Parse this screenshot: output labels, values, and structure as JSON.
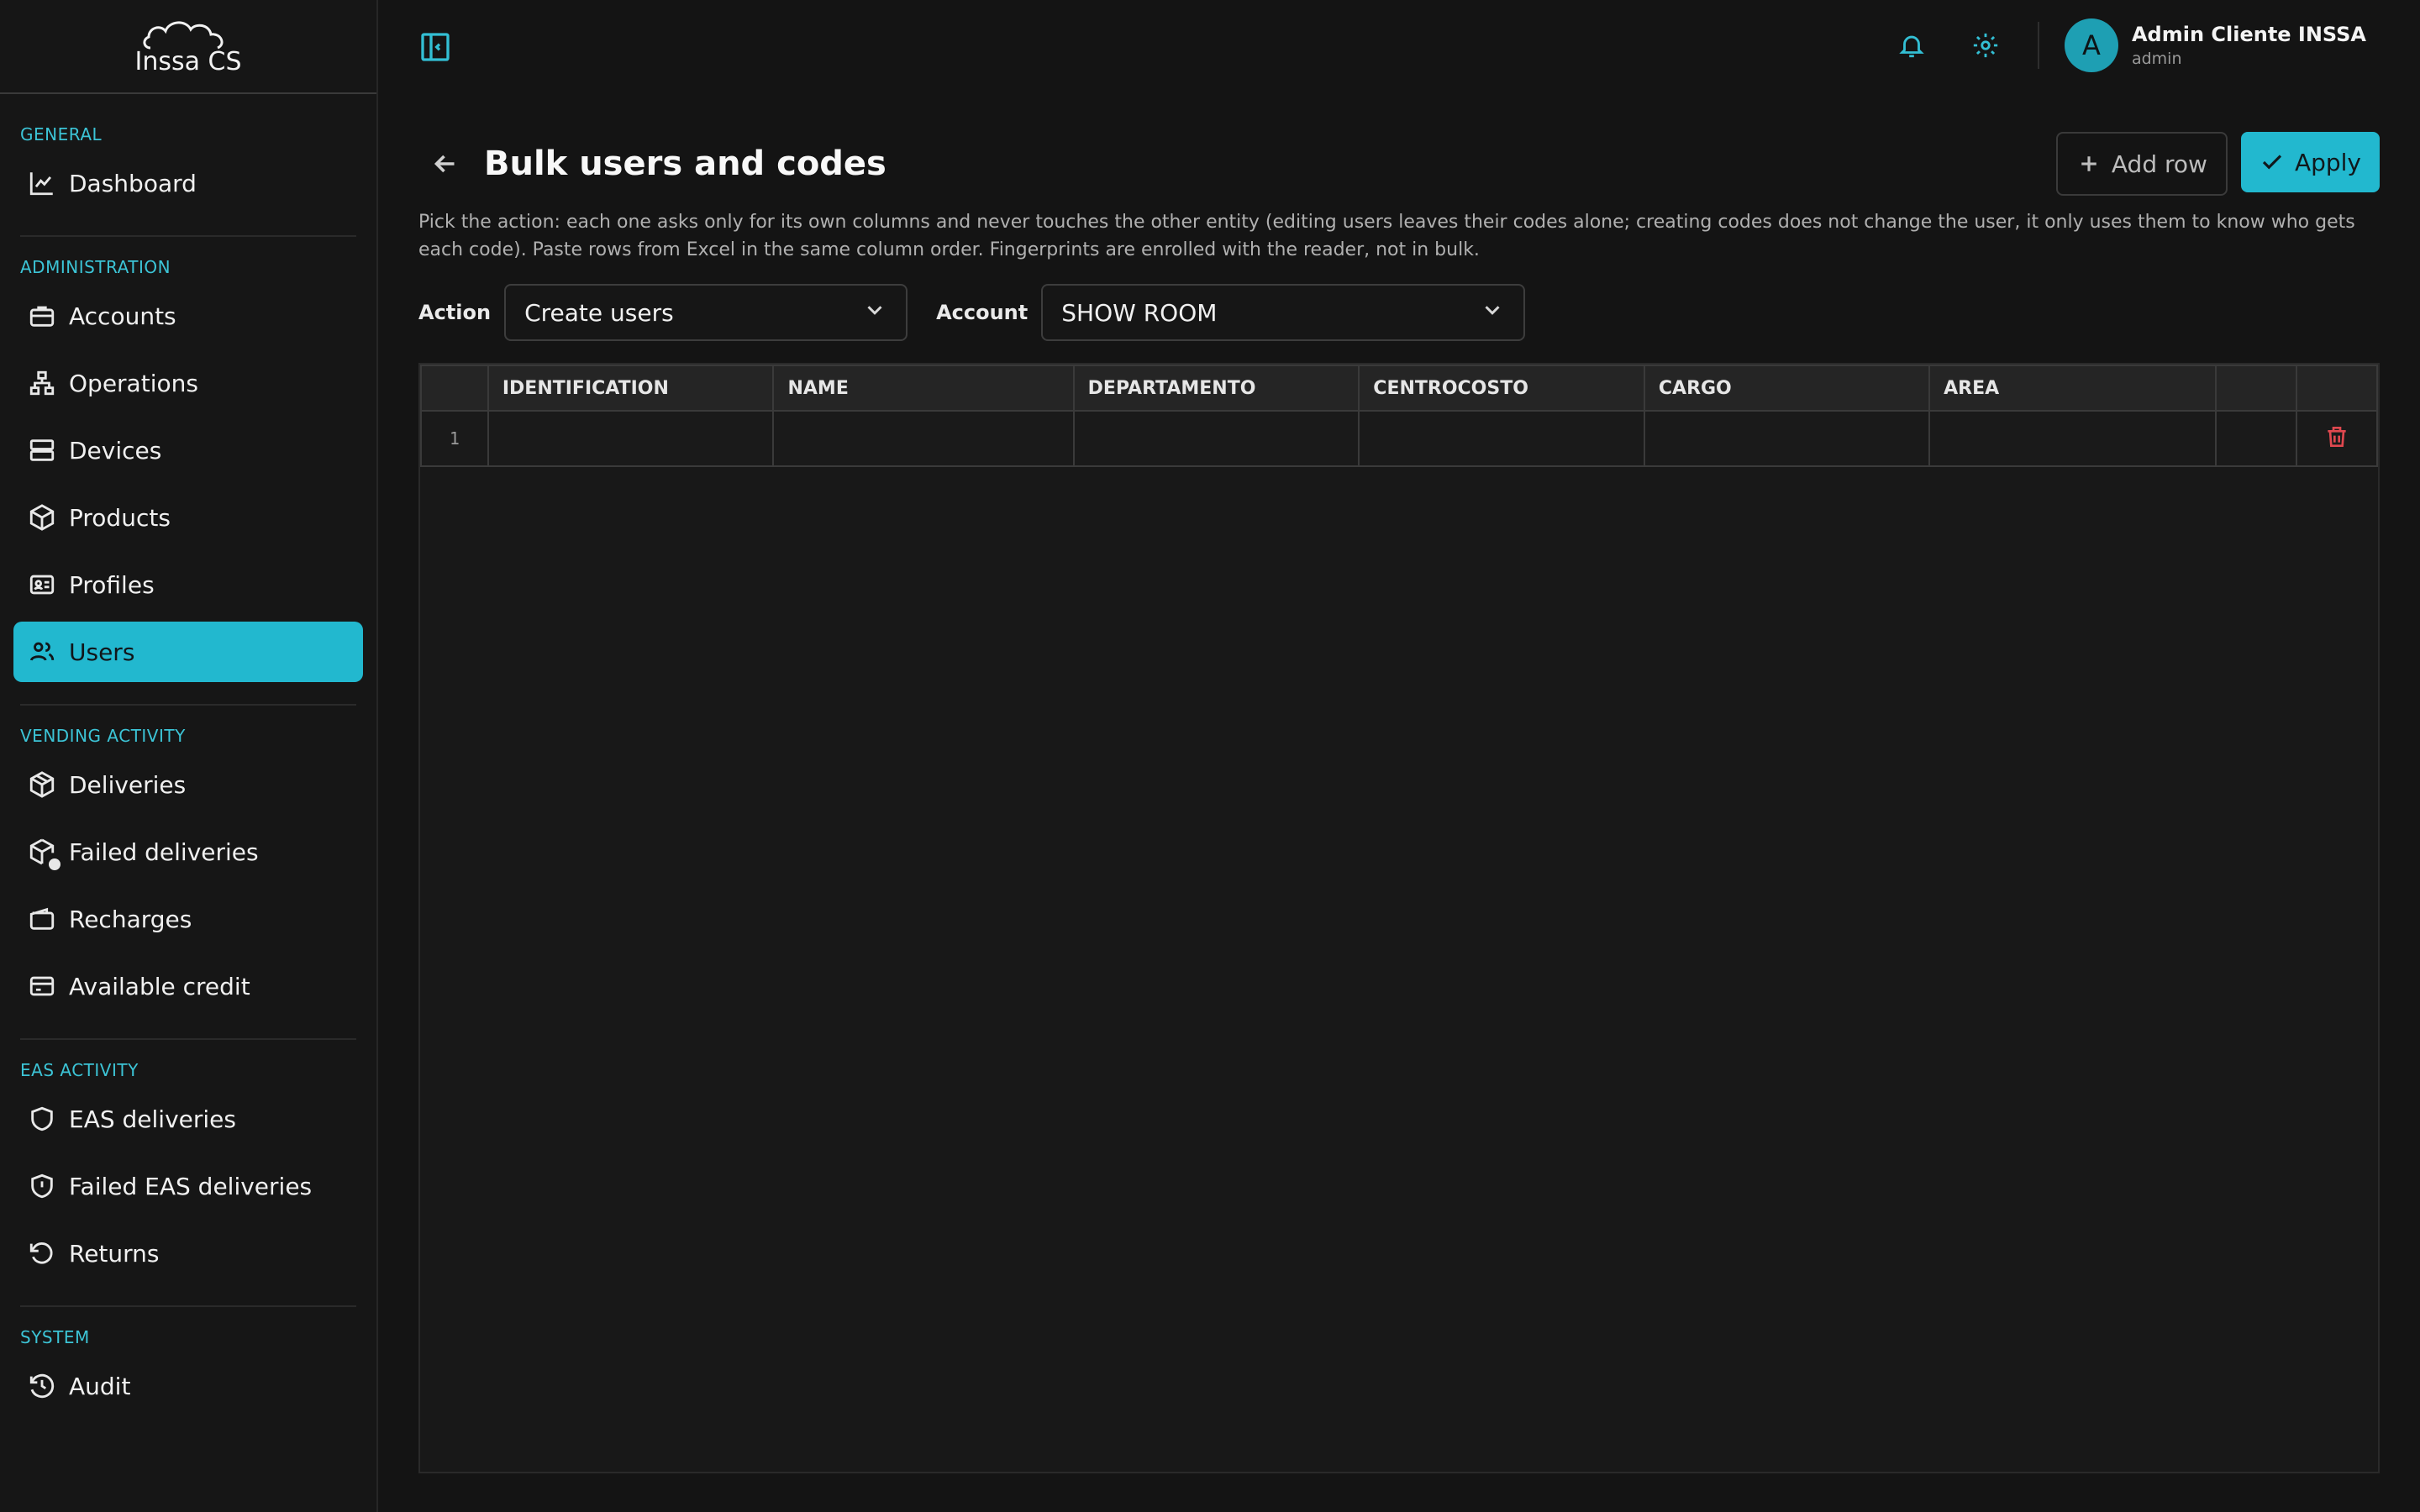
{
  "brand": {
    "logo_text": "Inssa CS"
  },
  "sidebar": {
    "sections": [
      {
        "title": "GENERAL",
        "items": [
          {
            "label": "Dashboard",
            "icon": "chart-line-icon"
          }
        ]
      },
      {
        "title": "ADMINISTRATION",
        "items": [
          {
            "label": "Accounts",
            "icon": "briefcase-icon"
          },
          {
            "label": "Operations",
            "icon": "network-icon"
          },
          {
            "label": "Devices",
            "icon": "server-icon"
          },
          {
            "label": "Products",
            "icon": "box-icon"
          },
          {
            "label": "Profiles",
            "icon": "id-card-icon"
          },
          {
            "label": "Users",
            "icon": "users-icon",
            "active": true
          }
        ]
      },
      {
        "title": "VENDING ACTIVITY",
        "items": [
          {
            "label": "Deliveries",
            "icon": "package-icon"
          },
          {
            "label": "Failed deliveries",
            "icon": "package-alert-icon"
          },
          {
            "label": "Recharges",
            "icon": "wallet-icon"
          },
          {
            "label": "Available credit",
            "icon": "credit-card-icon"
          }
        ]
      },
      {
        "title": "EAS ACTIVITY",
        "items": [
          {
            "label": "EAS deliveries",
            "icon": "shield-icon"
          },
          {
            "label": "Failed EAS deliveries",
            "icon": "shield-alert-icon"
          },
          {
            "label": "Returns",
            "icon": "rotate-ccw-icon"
          }
        ]
      },
      {
        "title": "SYSTEM",
        "items": [
          {
            "label": "Audit",
            "icon": "history-icon"
          }
        ]
      }
    ]
  },
  "topbar": {
    "user": {
      "initial": "A",
      "name": "Admin Cliente INSSA",
      "role": "admin"
    }
  },
  "page": {
    "title": "Bulk users and codes",
    "add_row_label": "Add row",
    "apply_label": "Apply",
    "description": "Pick the action: each one asks only for its own columns and never touches the other entity (editing users leaves their codes alone; creating codes does not change the user, it only uses them to know who gets each code). Paste rows from Excel in the same column order. Fingerprints are enrolled with the reader, not in bulk.",
    "action_label": "Action",
    "action_value": "Create users",
    "account_label": "Account",
    "account_value": "SHOW ROOM"
  },
  "grid": {
    "columns": [
      "IDENTIFICATION",
      "NAME",
      "DEPARTAMENTO",
      "CENTROCOSTO",
      "CARGO",
      "AREA"
    ],
    "rows": [
      {
        "number": "1",
        "cells": [
          "",
          "",
          "",
          "",
          "",
          ""
        ]
      }
    ]
  },
  "colors": {
    "accent": "#22b8cf",
    "danger": "#e0484f",
    "background": "#141414"
  }
}
